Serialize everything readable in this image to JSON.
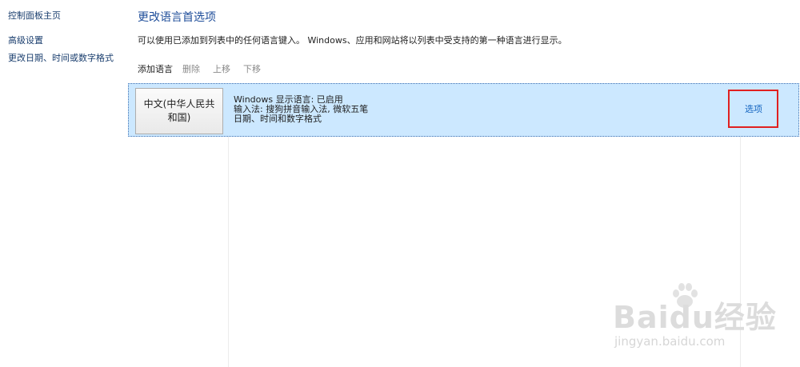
{
  "sidebar": {
    "home": "控制面板主页",
    "advanced": "高级设置",
    "date_time": "更改日期、时间或数字格式"
  },
  "main": {
    "title": "更改语言首选项",
    "description": "可以使用已添加到列表中的任何语言键入。 Windows、应用和网站将以列表中受支持的第一种语言进行显示。"
  },
  "toolbar": {
    "add": "添加语言",
    "remove": "删除",
    "move_up": "上移",
    "move_down": "下移"
  },
  "languages": [
    {
      "name": "中文(中华人民共和国)",
      "display": "Windows 显示语言: 已启用",
      "input": "输入法: 搜狗拼音输入法, 微软五笔",
      "format": "日期、时间和数字格式",
      "options": "选项"
    }
  ],
  "watermark": {
    "logo": "Baidu经验",
    "url": "jingyan.baidu.com"
  },
  "colors": {
    "selection_bg": "#cce8ff",
    "link": "#1565c0",
    "title": "#1f4e9a",
    "highlight_box": "#e02020",
    "disabled": "#8a8a8a"
  }
}
